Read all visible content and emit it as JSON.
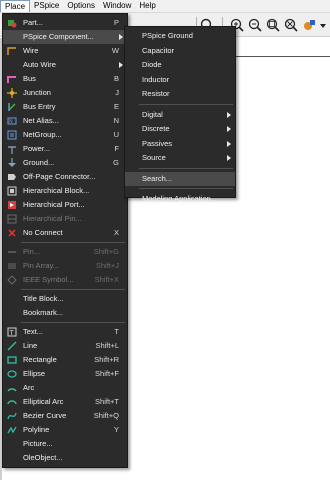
{
  "menubar": [
    "Place",
    "PSpice",
    "Options",
    "Window",
    "Help"
  ],
  "toolbar": {
    "icons": [
      "magnifier-icon",
      "zoom-in-icon",
      "zoom-out-icon",
      "zoom-area-icon",
      "zoom-all-icon",
      "probe-icon",
      "dropdown-icon"
    ]
  },
  "place_menu": [
    {
      "label": "Part...",
      "shortcut": "P",
      "icon": "part-icon",
      "color": "#3aa03a"
    },
    {
      "label": "PSpice Component...",
      "shortcut": "",
      "submenu": true,
      "highlight": true
    },
    {
      "label": "Wire",
      "shortcut": "W",
      "icon": "wire-icon",
      "color": "#e0a020"
    },
    {
      "label": "Auto Wire",
      "shortcut": "",
      "submenu": true
    },
    {
      "label": "Bus",
      "shortcut": "B",
      "icon": "bus-icon",
      "color": "#e060c0"
    },
    {
      "label": "Junction",
      "shortcut": "J",
      "icon": "junction-icon",
      "color": "#e0b020"
    },
    {
      "label": "Bus Entry",
      "shortcut": "E",
      "icon": "bus-entry-icon",
      "color": "#40c040"
    },
    {
      "label": "Net Alias...",
      "shortcut": "N",
      "icon": "net-alias-icon",
      "color": "#6a9ae0"
    },
    {
      "label": "NetGroup...",
      "shortcut": "U",
      "icon": "netgroup-icon",
      "color": "#6a9ae0"
    },
    {
      "label": "Power...",
      "shortcut": "F",
      "icon": "power-icon",
      "color": "#8aa0c0"
    },
    {
      "label": "Ground...",
      "shortcut": "G",
      "icon": "ground-icon",
      "color": "#8aa0c0"
    },
    {
      "label": "Off-Page Connector...",
      "shortcut": "",
      "icon": "offpage-icon",
      "color": "#d0d0d0"
    },
    {
      "label": "Hierarchical Block...",
      "shortcut": "",
      "icon": "hier-block-icon",
      "color": "#d0d0d0"
    },
    {
      "label": "Hierarchical Port...",
      "shortcut": "",
      "icon": "hier-port-icon",
      "color": "#d0d0d0"
    },
    {
      "label": "Hierarchical Pin...",
      "shortcut": "",
      "icon": "hier-pin-icon",
      "color": "#6a6a6a",
      "disabled": true
    },
    {
      "label": "No Connect",
      "shortcut": "X",
      "icon": "no-connect-icon",
      "color": "#e03030"
    },
    {
      "sep": true
    },
    {
      "label": "Pin...",
      "shortcut": "Shift+G",
      "icon": "pin-icon",
      "color": "#6a6a6a",
      "disabled": true
    },
    {
      "label": "Pin Array...",
      "shortcut": "Shift+J",
      "icon": "pin-array-icon",
      "color": "#6a6a6a",
      "disabled": true
    },
    {
      "label": "IEEE Symbol...",
      "shortcut": "Shift+X",
      "icon": "ieee-icon",
      "color": "#6a6a6a",
      "disabled": true
    },
    {
      "sep": true
    },
    {
      "label": "Title Block...",
      "shortcut": ""
    },
    {
      "label": "Bookmark...",
      "shortcut": ""
    },
    {
      "sep": true
    },
    {
      "label": "Text...",
      "shortcut": "T",
      "icon": "text-icon",
      "color": "#d0d0d0"
    },
    {
      "label": "Line",
      "shortcut": "Shift+L",
      "icon": "line-icon",
      "color": "#30c0a0"
    },
    {
      "label": "Rectangle",
      "shortcut": "Shift+R",
      "icon": "rectangle-icon",
      "color": "#30c0a0"
    },
    {
      "label": "Ellipse",
      "shortcut": "Shift+F",
      "icon": "ellipse-icon",
      "color": "#30c0a0"
    },
    {
      "label": "Arc",
      "shortcut": "",
      "icon": "arc-icon",
      "color": "#30c0a0"
    },
    {
      "label": "Elliptical Arc",
      "shortcut": "Shift+T",
      "icon": "elliptical-arc-icon",
      "color": "#30c0a0"
    },
    {
      "label": "Bezier Curve",
      "shortcut": "Shift+Q",
      "icon": "bezier-icon",
      "color": "#30c0a0"
    },
    {
      "label": "Polyline",
      "shortcut": "Y",
      "icon": "polyline-icon",
      "color": "#30c0a0"
    },
    {
      "label": "Picture...",
      "shortcut": ""
    },
    {
      "label": "OleObject...",
      "shortcut": ""
    }
  ],
  "pspice_submenu": [
    {
      "label": "PSpice Ground"
    },
    {
      "label": "Capacitor"
    },
    {
      "label": "Diode"
    },
    {
      "label": "Inductor"
    },
    {
      "label": "Resistor"
    },
    {
      "sep": true
    },
    {
      "label": "Digital",
      "submenu": true
    },
    {
      "label": "Discrete",
      "submenu": true
    },
    {
      "label": "Passives",
      "submenu": true
    },
    {
      "label": "Source",
      "submenu": true
    },
    {
      "sep": true
    },
    {
      "label": "Search...",
      "highlight": true
    },
    {
      "sep": true
    },
    {
      "label": "Modeling Application..."
    }
  ]
}
